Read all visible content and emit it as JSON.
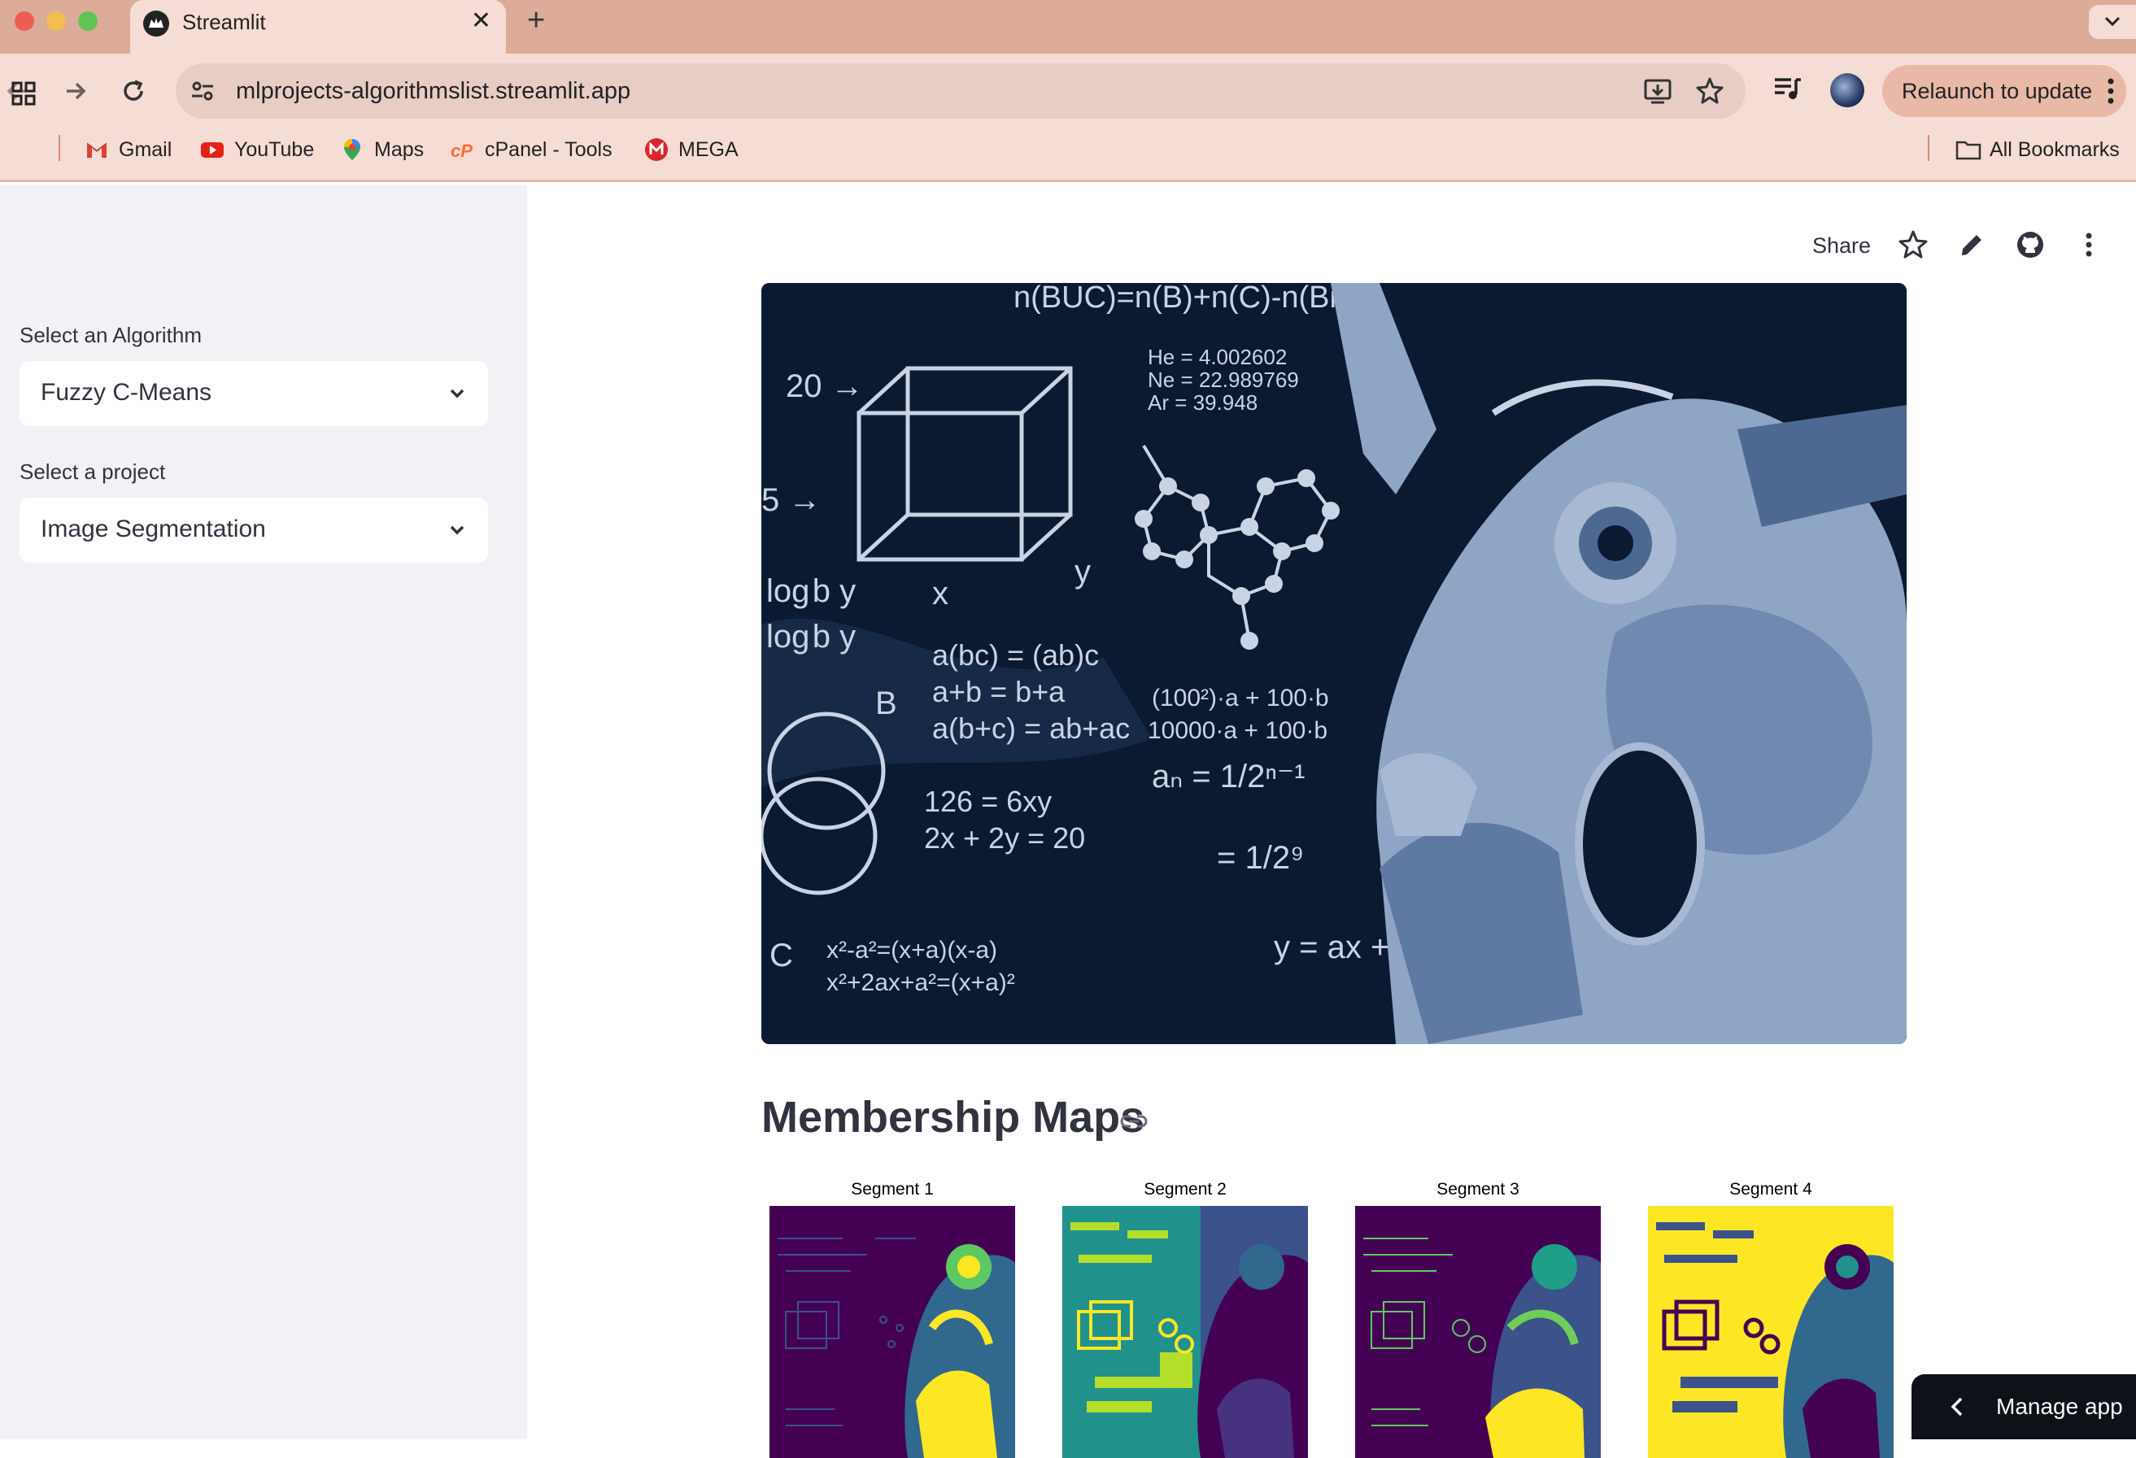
{
  "browser": {
    "tab_title": "Streamlit",
    "url": "mlprojects-algorithmslist.streamlit.app",
    "relaunch_label": "Relaunch to update",
    "bookmarks": [
      "Gmail",
      "YouTube",
      "Maps",
      "cPanel - Tools",
      "MEGA"
    ],
    "all_bookmarks_label": "All Bookmarks"
  },
  "sidebar": {
    "algorithm_label": "Select an Algorithm",
    "algorithm_value": "Fuzzy C-Means",
    "project_label": "Select a project",
    "project_value": "Image Segmentation"
  },
  "header": {
    "share_label": "Share"
  },
  "main": {
    "section_title": "Membership Maps",
    "segments": [
      "Segment 1",
      "Segment 2",
      "Segment 3",
      "Segment 4"
    ]
  },
  "manage_app_label": "Manage app",
  "colors": {
    "sidebar_bg": "#f0f2f6",
    "text": "#31333f",
    "viridis_dark": "#440154",
    "viridis_mid": "#21918c",
    "viridis_light": "#fde725"
  }
}
